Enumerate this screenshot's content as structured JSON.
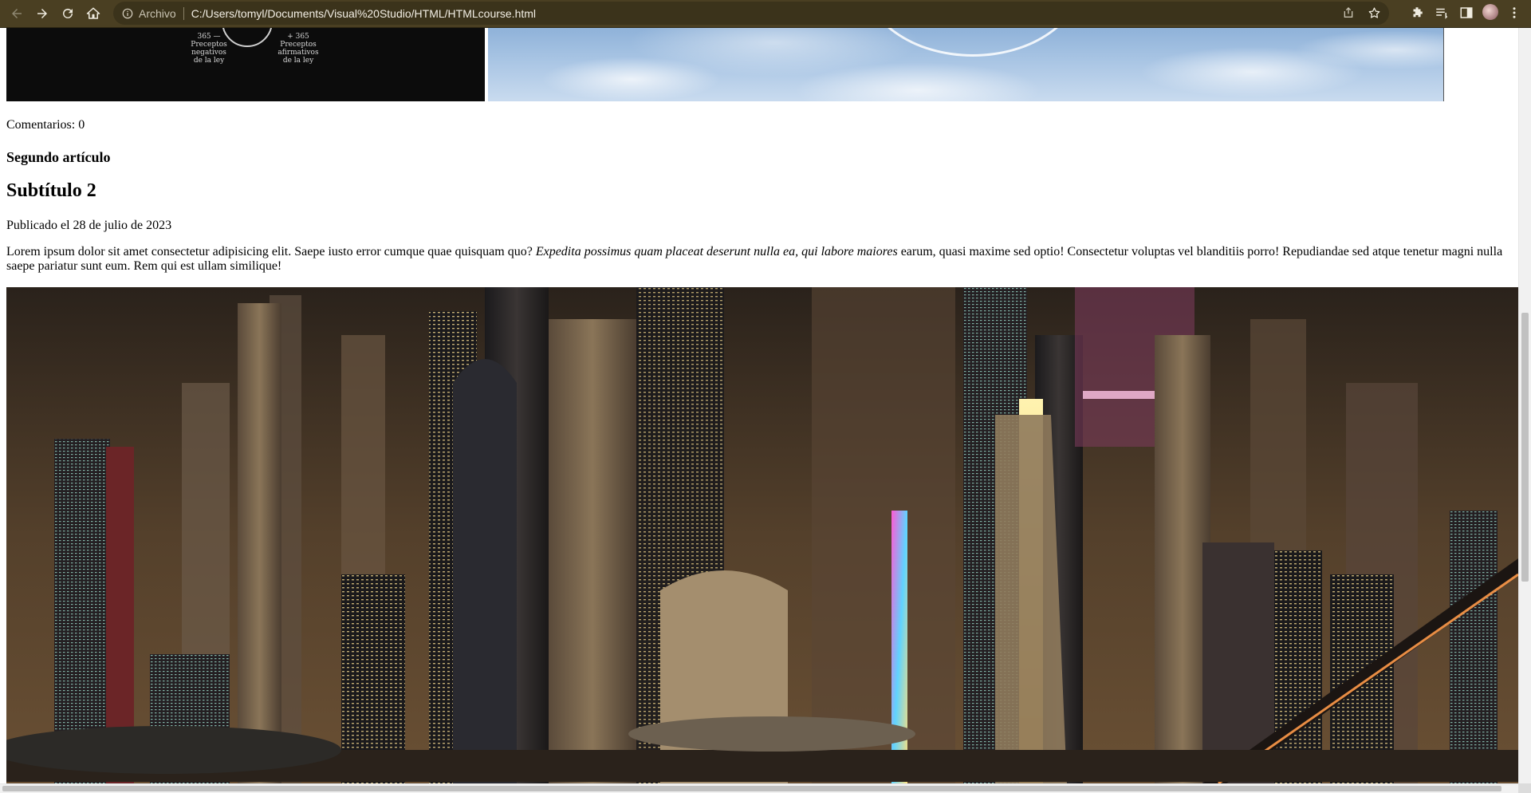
{
  "browser": {
    "scheme_label": "Archivo",
    "url": "C:/Users/tomyl/Documents/Visual%20Studio/HTML/HTMLcourse.html",
    "icons": [
      "back-icon",
      "forward-icon",
      "reload-icon",
      "home-icon",
      "info-icon",
      "share-icon",
      "bookmark-star-icon",
      "extensions-icon",
      "reading-list-icon",
      "side-panel-icon",
      "profile-avatar",
      "menu-icon"
    ]
  },
  "colors": {
    "chrome_bg": "#4a3f22",
    "omnibox_bg": "#3b331b"
  },
  "top_image": {
    "left_caption": "365 — Preceptos negativos de la ley",
    "right_caption": "+ 365 Preceptos afirmativos de la ley"
  },
  "article": {
    "comments": "Comentarios: 0",
    "title": "Segundo artículo",
    "subtitle": "Subtítulo 2",
    "published": "Publicado el 28 de julio de 2023",
    "paragraph_start": "Lorem ipsum dolor sit amet consectetur adipisicing elit. Saepe iusto error cumque quae quisquam quo? ",
    "paragraph_italic": "Expedita possimus quam placeat deserunt nulla ea, qui labore maiores",
    "paragraph_end": " earum, quasi maxime sed optio! Consectetur voluptas vel blanditiis porro! Repudiandae sed atque tenetur magni nulla saepe pariatur sunt eum. Rem qui est ullam similique!"
  }
}
